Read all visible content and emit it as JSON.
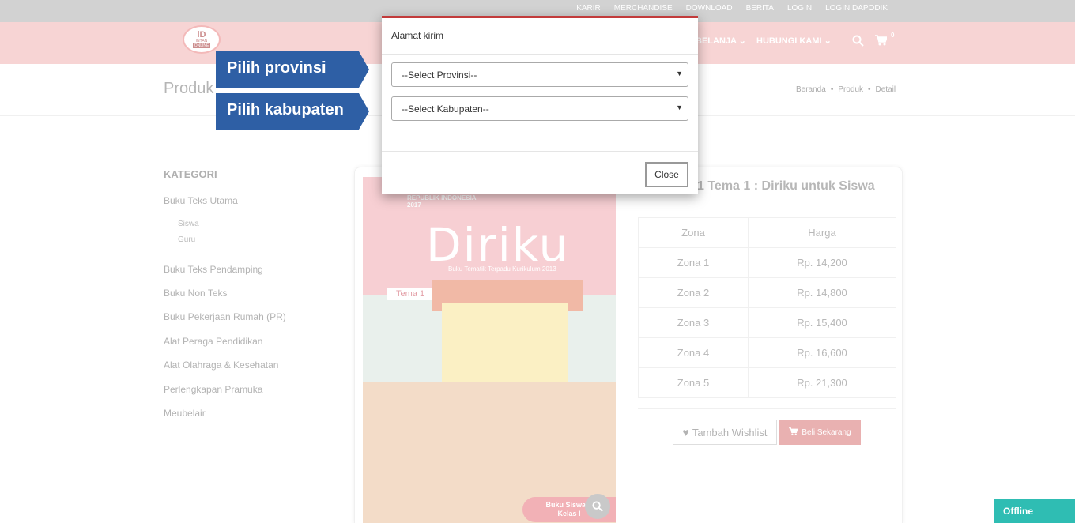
{
  "topbar": {
    "links": [
      "KARIR",
      "MERCHANDISE",
      "DOWNLOAD",
      "BERITA",
      "LOGIN",
      "LOGIN DAPODIK"
    ]
  },
  "logo": {
    "line1": "iD",
    "line2": "INTAN",
    "line3": "ONLINE"
  },
  "navbar": {
    "items": [
      "BELANJA",
      "HUBUNGI KAMI"
    ],
    "cart_count": "0"
  },
  "page": {
    "title": "Produk",
    "breadcrumb": [
      "Beranda",
      "Produk",
      "Detail"
    ]
  },
  "sidebar": {
    "title": "KATEGORI",
    "items": [
      "Buku Teks Utama",
      "Buku Teks Pendamping",
      "Buku Non Teks",
      "Buku Pekerjaan Rumah (PR)",
      "Alat Peraga Pendidikan",
      "Alat Olahraga & Kesehatan",
      "Perlengkapan Pramuka",
      "Meubelair"
    ],
    "subitems": [
      "Siswa",
      "Guru"
    ]
  },
  "cover": {
    "ministry": "REPUBLIK INDONESIA",
    "year": "2017",
    "title": "Diriku",
    "subtitle": "Buku Tematik Terpadu Kurikulum 2013",
    "tema": "Tema 1",
    "badge_line1": "Buku Siswa S",
    "badge_line2": "Kelas I"
  },
  "product": {
    "title": "1 Tema 1 : Diriku untuk Siswa",
    "table_headers": [
      "Zona",
      "Harga"
    ],
    "prices": [
      [
        "Zona 1",
        "Rp. 14,200"
      ],
      [
        "Zona 2",
        "Rp. 14,800"
      ],
      [
        "Zona 3",
        "Rp. 15,400"
      ],
      [
        "Zona 4",
        "Rp. 16,600"
      ],
      [
        "Zona 5",
        "Rp. 21,300"
      ]
    ],
    "wishlist_label": "Tambah Wishlist",
    "buy_label": "Beli Sekarang"
  },
  "modal": {
    "title": "Alamat kirim",
    "province_selected": "--Select Provinsi--",
    "regency_selected": "--Select Kabupaten--",
    "close_label": "Close"
  },
  "annotations": {
    "province": "Pilih provinsi",
    "regency": "Pilih kabupaten"
  },
  "chat": {
    "status": "Offline"
  },
  "colors": {
    "accent": "#c23b3b",
    "callout": "#2e5fa5",
    "chat": "#2fbdb3",
    "navbar": "#f7d4d4"
  }
}
